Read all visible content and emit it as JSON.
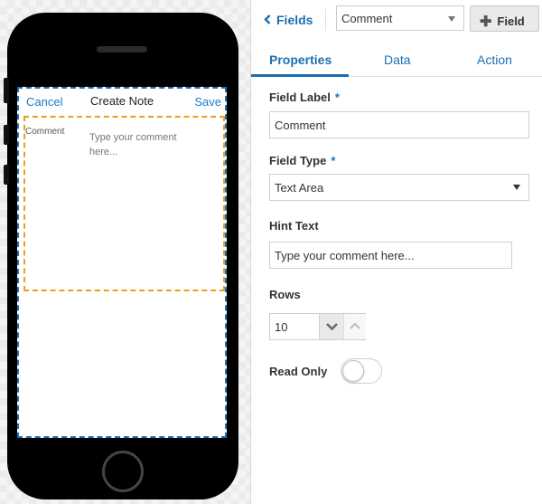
{
  "phone": {
    "header": {
      "cancel": "Cancel",
      "title": "Create Note",
      "save": "Save"
    },
    "field": {
      "label": "Comment",
      "hint": "Type your comment here..."
    }
  },
  "panel": {
    "back_label": "Fields",
    "field_select": "Comment",
    "add_field_label": "Field",
    "tabs": [
      {
        "label": "Properties",
        "active": true
      },
      {
        "label": "Data",
        "active": false
      },
      {
        "label": "Action",
        "active": false
      }
    ],
    "form": {
      "field_label": {
        "label": "Field Label",
        "required": "*",
        "value": "Comment"
      },
      "field_type": {
        "label": "Field Type",
        "required": "*",
        "value": "Text Area"
      },
      "hint_text": {
        "label": "Hint Text",
        "value": "Type your comment here..."
      },
      "rows": {
        "label": "Rows",
        "value": "10"
      },
      "read_only": {
        "label": "Read Only",
        "on": false
      }
    }
  },
  "colors": {
    "accent": "#1a6fb4",
    "selection_border": "#e8a21c",
    "screen_border": "#1f6fb0"
  }
}
